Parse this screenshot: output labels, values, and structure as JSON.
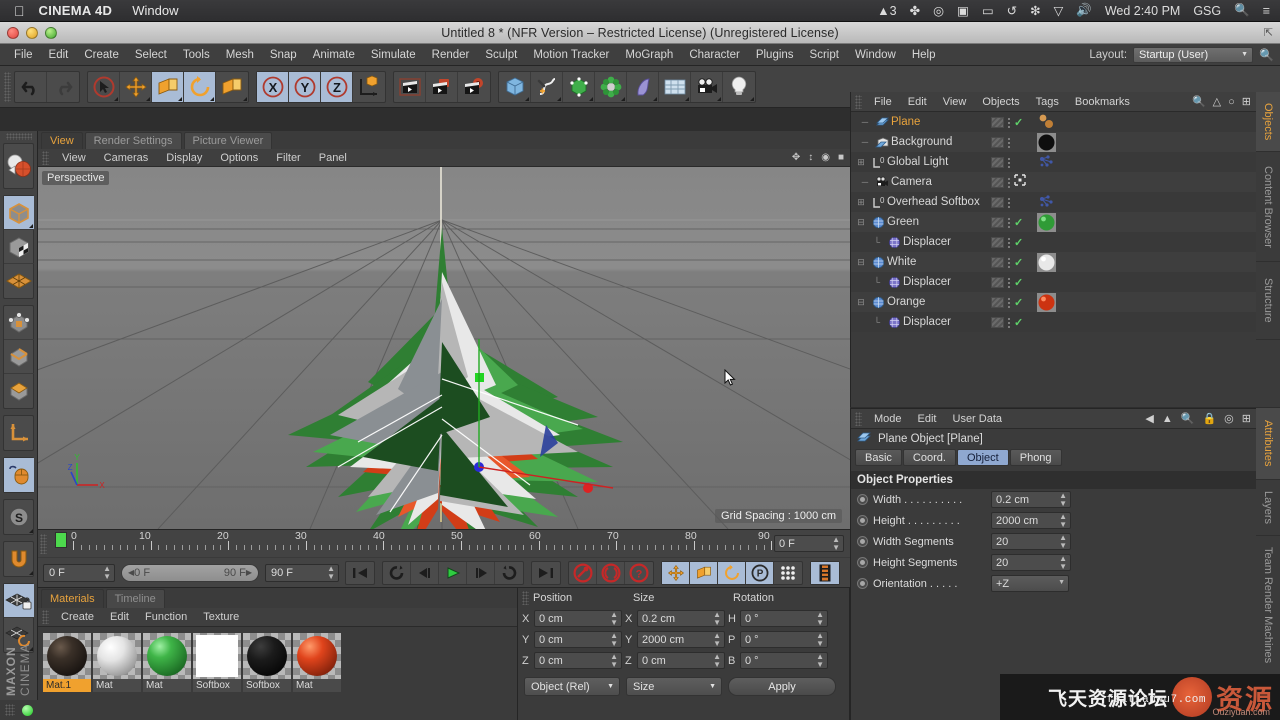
{
  "macbar": {
    "apple_icon": "apple-icon",
    "app_name": "CINEMA 4D",
    "menus": [
      "Window"
    ],
    "status_items": [
      {
        "name": "adobe-cc-count",
        "label": "3"
      },
      {
        "name": "dropbox-icon",
        "label": "✤"
      },
      {
        "name": "creative-cloud-icon",
        "label": "◎"
      },
      {
        "name": "screen-record-icon",
        "label": "▣"
      },
      {
        "name": "airplay-icon",
        "label": "▭"
      },
      {
        "name": "time-machine-icon",
        "label": "↺"
      },
      {
        "name": "bluetooth-icon",
        "label": "❇"
      },
      {
        "name": "battery-icon",
        "label": "▽"
      },
      {
        "name": "volume-icon",
        "label": "◂))"
      }
    ],
    "clock": "Wed 2:40 PM",
    "user": "GSG",
    "search_icon": "search-icon",
    "notification_icon": "notification-list-icon"
  },
  "window": {
    "title": "Untitled 8 * (NFR Version – Restricted License) (Unregistered License)"
  },
  "appmenu": {
    "items": [
      "File",
      "Edit",
      "Create",
      "Select",
      "Tools",
      "Mesh",
      "Snap",
      "Animate",
      "Simulate",
      "Render",
      "Sculpt",
      "Motion Tracker",
      "MoGraph",
      "Character",
      "Plugins",
      "Script",
      "Window",
      "Help"
    ],
    "layout_label": "Layout:",
    "layout_value": "Startup (User)"
  },
  "toolbar": {
    "groups": [
      {
        "name": "history",
        "buttons": [
          {
            "name": "undo-button",
            "icon": "undo-arrow"
          },
          {
            "name": "redo-button",
            "icon": "redo-arrow"
          }
        ]
      },
      {
        "name": "tools",
        "buttons": [
          {
            "name": "live-selection-tool",
            "icon": "cursor-circle"
          },
          {
            "name": "move-tool",
            "icon": "move-cross"
          },
          {
            "name": "scale-tool",
            "icon": "scale-box"
          },
          {
            "name": "rotate-tool",
            "icon": "rotate-circle"
          },
          {
            "name": "modeling-axis-tool",
            "icon": "axis-box"
          }
        ]
      },
      {
        "name": "axis-locks",
        "buttons": [
          {
            "name": "x-axis-lock",
            "icon": "x-letter"
          },
          {
            "name": "y-axis-lock",
            "icon": "y-letter"
          },
          {
            "name": "z-axis-lock",
            "icon": "z-letter"
          },
          {
            "name": "world-object-coord",
            "icon": "world-axis-cube"
          }
        ]
      },
      {
        "name": "render",
        "buttons": [
          {
            "name": "render-view-button",
            "icon": "clapper"
          },
          {
            "name": "render-region-button",
            "icon": "clapper-region"
          },
          {
            "name": "render-settings-button",
            "icon": "clapper-gear"
          }
        ]
      },
      {
        "name": "create",
        "buttons": [
          {
            "name": "add-cube-button",
            "icon": "blue-cube"
          },
          {
            "name": "add-spline-button",
            "icon": "spline-pen"
          },
          {
            "name": "add-nurbs-button",
            "icon": "green-cube"
          },
          {
            "name": "add-array-button",
            "icon": "green-cluster"
          },
          {
            "name": "add-deformer-button",
            "icon": "purple-bend"
          },
          {
            "name": "add-environment-button",
            "icon": "floor-grid"
          },
          {
            "name": "add-camera-button",
            "icon": "camera"
          },
          {
            "name": "add-light-button",
            "icon": "lightbulb"
          }
        ]
      }
    ]
  },
  "lefttools": {
    "groups": [
      [
        {
          "name": "texture-axis-tool",
          "icon": "sphere-globe"
        }
      ],
      [
        {
          "name": "model-mode-tool",
          "icon": "grey-cube"
        },
        {
          "name": "texture-mode-tool",
          "icon": "checker-cube"
        },
        {
          "name": "workplane-tool",
          "icon": "orange-grid"
        }
      ],
      [
        {
          "name": "points-mode-tool",
          "icon": "points-cube"
        },
        {
          "name": "edges-mode-tool",
          "icon": "edges-cube"
        },
        {
          "name": "polygons-mode-tool",
          "icon": "polygon-cube"
        }
      ],
      [
        {
          "name": "object-axis-tool",
          "icon": "axis-l"
        }
      ],
      [
        {
          "name": "viewport-solo-tool",
          "icon": "mouse-icon"
        }
      ],
      [
        {
          "name": "snap-settings-tool",
          "icon": "s-compass"
        }
      ],
      [
        {
          "name": "enable-snap-tool",
          "icon": "magnet-icon"
        }
      ],
      [
        {
          "name": "lock-workplane-tool",
          "icon": "grid-lock"
        },
        {
          "name": "workplane-rotate-tool",
          "icon": "grid-rotate"
        }
      ]
    ],
    "brand_top": "MAXON",
    "brand_bottom": "CINEMA",
    "status_dot": "green-status-dot"
  },
  "viewport": {
    "tabs": [
      {
        "name": "tab-view",
        "label": "View",
        "active": true
      },
      {
        "name": "tab-render-settings",
        "label": "Render Settings",
        "active": false
      },
      {
        "name": "tab-picture-viewer",
        "label": "Picture Viewer",
        "active": false
      }
    ],
    "menus": [
      "View",
      "Cameras",
      "Display",
      "Options",
      "Filter",
      "Panel"
    ],
    "label": "Perspective",
    "grid_spacing": "Grid Spacing : 1000 cm",
    "axis_labels": {
      "y": "Y",
      "x": "X",
      "z": "Z"
    }
  },
  "timeline": {
    "ticks": [
      0,
      10,
      20,
      30,
      40,
      50,
      60,
      70,
      80,
      90
    ],
    "playhead_frame": 0,
    "current_frame_field": "0 F",
    "range_start": "0 F",
    "range_end": "90 F",
    "end_field": "90 F",
    "left_field": "0 F",
    "transport_buttons": [
      {
        "name": "goto-start-button",
        "icon": "skip-back"
      },
      {
        "name": "loop-button",
        "icon": "loop-arrow"
      },
      {
        "name": "step-back-button",
        "icon": "prev-frame"
      },
      {
        "name": "play-button",
        "icon": "play-triangle"
      },
      {
        "name": "step-forward-button",
        "icon": "next-frame"
      },
      {
        "name": "play-reverse-button",
        "icon": "reverse-arrow"
      },
      {
        "name": "goto-end-button",
        "icon": "skip-forward"
      }
    ],
    "key_buttons": [
      {
        "name": "record-keyframe-button",
        "icon": "red-key"
      },
      {
        "name": "autokey-button",
        "icon": "red-circle-key"
      },
      {
        "name": "keyframe-selection-button",
        "icon": "red-question"
      }
    ],
    "param_buttons": [
      {
        "name": "position-key-button",
        "icon": "move-cross"
      },
      {
        "name": "scale-key-button",
        "icon": "scale-box"
      },
      {
        "name": "rotation-key-button",
        "icon": "rotate-circle"
      },
      {
        "name": "pla-key-button",
        "icon": "p-circle"
      },
      {
        "name": "param-grid-button",
        "icon": "dot-grid"
      }
    ],
    "layer_button": {
      "name": "timeline-layers-button",
      "icon": "film-strip"
    }
  },
  "materials": {
    "tabs": [
      {
        "name": "tab-materials",
        "label": "Materials",
        "active": true
      },
      {
        "name": "tab-timeline",
        "label": "Timeline",
        "active": false
      }
    ],
    "menus": [
      "Create",
      "Edit",
      "Function",
      "Texture"
    ],
    "items": [
      {
        "name": "Mat.1",
        "type": "ball",
        "color": "#2d2520",
        "selected": true
      },
      {
        "name": "Mat",
        "type": "ball",
        "color": "#e2e2e2",
        "selected": false
      },
      {
        "name": "Mat",
        "type": "ball",
        "color": "#35a03c",
        "selected": false
      },
      {
        "name": "Softbox",
        "type": "flat",
        "color": "#ffffff",
        "selected": false
      },
      {
        "name": "Softbox",
        "type": "ball",
        "color": "#161616",
        "selected": false
      },
      {
        "name": "Mat",
        "type": "ball",
        "color": "#d6381a",
        "selected": false
      }
    ]
  },
  "coordinates": {
    "headers": [
      "Position",
      "Size",
      "Rotation"
    ],
    "rows": [
      {
        "pos_axis": "X",
        "pos": "0 cm",
        "size_axis": "X",
        "size": "0.2 cm",
        "rot_axis": "H",
        "rot": "0 °"
      },
      {
        "pos_axis": "Y",
        "pos": "0 cm",
        "size_axis": "Y",
        "size": "2000 cm",
        "rot_axis": "P",
        "rot": "0 °"
      },
      {
        "pos_axis": "Z",
        "pos": "0 cm",
        "size_axis": "Z",
        "size": "0 cm",
        "rot_axis": "B",
        "rot": "0 °"
      }
    ],
    "mode_select": "Object (Rel)",
    "size_select": "Size",
    "apply_label": "Apply"
  },
  "objects": {
    "menus": [
      "File",
      "Edit",
      "View",
      "Objects",
      "Tags",
      "Bookmarks"
    ],
    "header_icons": [
      "search-icon",
      "home-icon",
      "ellipse-icon",
      "plus-box-icon"
    ],
    "items": [
      {
        "name": "Plane",
        "indent": 0,
        "expander": "none",
        "icon": "plane-object-icon",
        "selected": true,
        "check": true,
        "tag": "two-dot-orange",
        "mat": "#c88a4c",
        "matshape": "dots"
      },
      {
        "name": "Background",
        "indent": 0,
        "expander": "none",
        "icon": "background-object-icon",
        "selected": false,
        "check": false,
        "mat": "#141414",
        "matshape": "ball"
      },
      {
        "name": "Global Light",
        "indent": 0,
        "expander": "plus",
        "icon": "light-layer-icon",
        "selected": false,
        "check": false,
        "mat": "#3b4c8c",
        "matshape": "cluster"
      },
      {
        "name": "Camera",
        "indent": 0,
        "expander": "none",
        "icon": "camera-object-icon",
        "selected": false,
        "check": false,
        "special": "target-tag"
      },
      {
        "name": "Overhead Softbox",
        "indent": 0,
        "expander": "plus",
        "icon": "light-layer-icon",
        "selected": false,
        "check": false,
        "mat": "#3b4c8c",
        "matshape": "cluster"
      },
      {
        "name": "Green",
        "indent": 0,
        "expander": "minus",
        "icon": "mograph-object-icon",
        "selected": false,
        "check": true,
        "mat": "#2f9b36",
        "matshape": "ball"
      },
      {
        "name": "Displacer",
        "indent": 1,
        "expander": "none",
        "icon": "displacer-icon",
        "selected": false,
        "check": true
      },
      {
        "name": "White",
        "indent": 0,
        "expander": "minus",
        "icon": "mograph-object-icon",
        "selected": false,
        "check": true,
        "mat": "#e6e6e6",
        "matshape": "ball"
      },
      {
        "name": "Displacer",
        "indent": 1,
        "expander": "none",
        "icon": "displacer-icon",
        "selected": false,
        "check": true
      },
      {
        "name": "Orange",
        "indent": 0,
        "expander": "minus",
        "icon": "mograph-object-icon",
        "selected": false,
        "check": true,
        "mat": "#cc3311",
        "matshape": "ball"
      },
      {
        "name": "Displacer",
        "indent": 1,
        "expander": "none",
        "icon": "displacer-icon",
        "selected": false,
        "check": true
      }
    ],
    "side_tabs": [
      {
        "name": "vtab-objects",
        "label": "Objects",
        "active": true
      },
      {
        "name": "vtab-content-browser",
        "label": "Content Browser",
        "active": false
      },
      {
        "name": "vtab-structure",
        "label": "Structure",
        "active": false
      }
    ]
  },
  "attributes": {
    "menus": [
      "Mode",
      "Edit",
      "User Data"
    ],
    "header_icons": [
      "back-arrow-icon",
      "up-arrow-icon",
      "search-icon",
      "lock-icon",
      "target-icon",
      "plus-box-icon"
    ],
    "object_title": "Plane Object [Plane]",
    "object_icon": "plane-object-icon",
    "tabs": [
      {
        "name": "attr-tab-basic",
        "label": "Basic",
        "active": false
      },
      {
        "name": "attr-tab-coord",
        "label": "Coord.",
        "active": false
      },
      {
        "name": "attr-tab-object",
        "label": "Object",
        "active": true
      },
      {
        "name": "attr-tab-phong",
        "label": "Phong",
        "active": false
      }
    ],
    "section_title": "Object Properties",
    "properties": [
      {
        "label": "Width . . . . . . . . . .",
        "value": "0.2 cm",
        "type": "spin"
      },
      {
        "label": "Height . . . . . . . . .",
        "value": "2000 cm",
        "type": "spin"
      },
      {
        "label": "Width Segments",
        "value": "20",
        "type": "spin"
      },
      {
        "label": "Height Segments",
        "value": "20",
        "type": "spin"
      },
      {
        "label": "Orientation . . . . .",
        "value": "+Z",
        "type": "select"
      }
    ],
    "side_tabs": [
      {
        "name": "vtab-attributes",
        "label": "Attributes",
        "active": true
      },
      {
        "name": "vtab-layers",
        "label": "Layers",
        "active": false
      },
      {
        "name": "vtab-team-render",
        "label": "Team Render Machines",
        "active": false
      }
    ]
  },
  "watermark": {
    "text_cn": "飞天资源论坛",
    "big_cn": "资源",
    "url": "Ouziyuan.com",
    "url2": "feitianwu7.com"
  },
  "colors": {
    "accent_orange": "#e8a33d",
    "panel_bg": "#3b3b3b",
    "toolbar_bg": "#434343",
    "active_tab_blue": "#8fa8d0",
    "check_green": "#5fd36a"
  }
}
